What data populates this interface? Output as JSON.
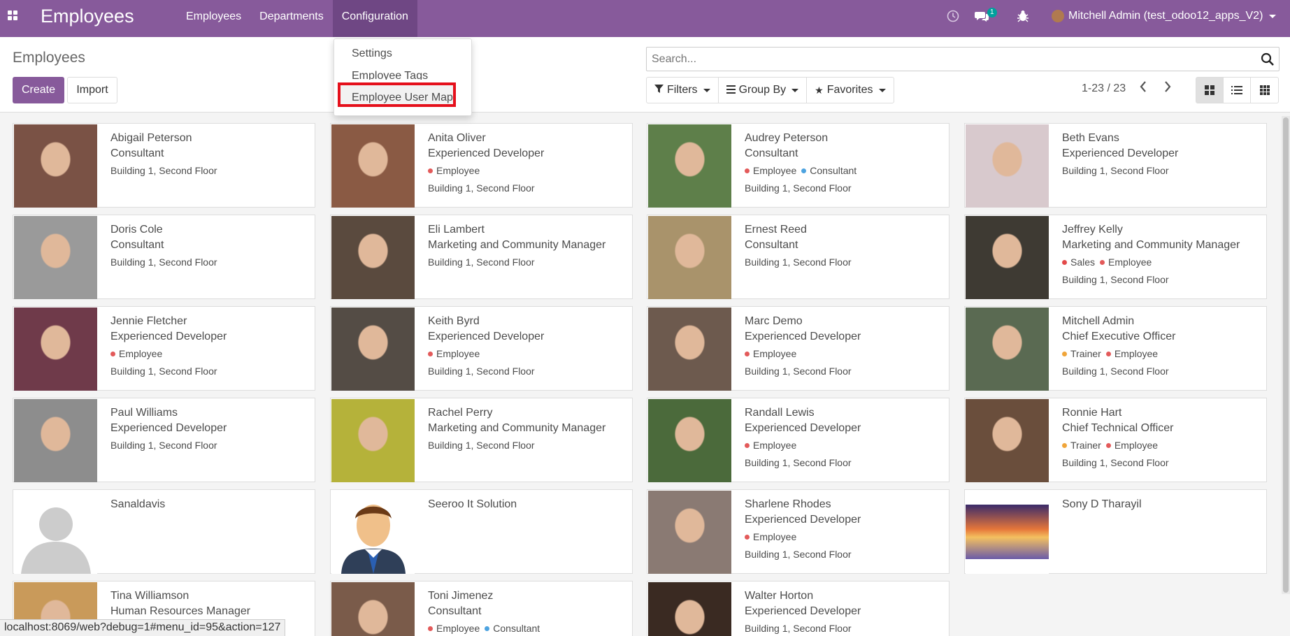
{
  "app": {
    "brand": "Employees",
    "menus": [
      {
        "label": "Employees"
      },
      {
        "label": "Departments"
      },
      {
        "label": "Configuration"
      }
    ],
    "chat_badge": "1",
    "user_label": "Mitchell Admin (test_odoo12_apps_V2)"
  },
  "dropdown": {
    "items": [
      {
        "label": "Settings"
      },
      {
        "label": "Employee Tags"
      },
      {
        "label": "Employee User Map"
      }
    ]
  },
  "control_panel": {
    "title": "Employees",
    "create_label": "Create",
    "import_label": "Import",
    "search_placeholder": "Search...",
    "filters_label": "Filters",
    "groupby_label": "Group By",
    "favorites_label": "Favorites",
    "pager": "1-23 / 23"
  },
  "tag_colors": {
    "Employee": "#e35a5a",
    "Consultant": "#4da3e0",
    "Sales": "#e34a4a",
    "Trainer": "#f0a53a"
  },
  "employees": [
    {
      "name": "Abigail Peterson",
      "job": "Consultant",
      "tags": [],
      "location": "Building 1, Second Floor",
      "photo": "#7a5245"
    },
    {
      "name": "Anita Oliver",
      "job": "Experienced Developer",
      "tags": [
        "Employee"
      ],
      "location": "Building 1, Second Floor",
      "photo": "#8a5a44"
    },
    {
      "name": "Audrey Peterson",
      "job": "Consultant",
      "tags": [
        "Employee",
        "Consultant"
      ],
      "location": "Building 1, Second Floor",
      "photo": "#5e7f4a"
    },
    {
      "name": "Beth Evans",
      "job": "Experienced Developer",
      "tags": [],
      "location": "Building 1, Second Floor",
      "photo": "#d8c9cd"
    },
    {
      "name": "Doris Cole",
      "job": "Consultant",
      "tags": [],
      "location": "Building 1, Second Floor",
      "photo": "#9a9a9a"
    },
    {
      "name": "Eli Lambert",
      "job": "Marketing and Community Manager",
      "tags": [],
      "location": "Building 1, Second Floor",
      "photo": "#5a4a3e"
    },
    {
      "name": "Ernest Reed",
      "job": "Consultant",
      "tags": [],
      "location": "Building 1, Second Floor",
      "photo": "#a9936b"
    },
    {
      "name": "Jeffrey Kelly",
      "job": "Marketing and Community Manager",
      "tags": [
        "Sales",
        "Employee"
      ],
      "location": "Building 1, Second Floor",
      "photo": "#3e3a33"
    },
    {
      "name": "Jennie Fletcher",
      "job": "Experienced Developer",
      "tags": [
        "Employee"
      ],
      "location": "Building 1, Second Floor",
      "photo": "#6f3a4a"
    },
    {
      "name": "Keith Byrd",
      "job": "Experienced Developer",
      "tags": [
        "Employee"
      ],
      "location": "Building 1, Second Floor",
      "photo": "#544c45"
    },
    {
      "name": "Marc Demo",
      "job": "Experienced Developer",
      "tags": [
        "Employee"
      ],
      "location": "Building 1, Second Floor",
      "photo": "#6d5a4e"
    },
    {
      "name": "Mitchell Admin",
      "job": "Chief Executive Officer",
      "tags": [
        "Trainer",
        "Employee"
      ],
      "location": "Building 1, Second Floor",
      "photo": "#5a6a52"
    },
    {
      "name": "Paul Williams",
      "job": "Experienced Developer",
      "tags": [],
      "location": "Building 1, Second Floor",
      "photo": "#8d8d8d"
    },
    {
      "name": "Rachel Perry",
      "job": "Marketing and Community Manager",
      "tags": [],
      "location": "Building 1, Second Floor",
      "photo": "#b5b23a"
    },
    {
      "name": "Randall Lewis",
      "job": "Experienced Developer",
      "tags": [
        "Employee"
      ],
      "location": "Building 1, Second Floor",
      "photo": "#4b6a3b"
    },
    {
      "name": "Ronnie Hart",
      "job": "Chief Technical Officer",
      "tags": [
        "Trainer",
        "Employee"
      ],
      "location": "Building 1, Second Floor",
      "photo": "#6a4e3c"
    },
    {
      "name": "Sanaldavis",
      "job": "",
      "tags": [],
      "location": "",
      "photo": "placeholder"
    },
    {
      "name": "Seeroo It Solution",
      "job": "",
      "tags": [],
      "location": "",
      "photo": "cartoon"
    },
    {
      "name": "Sharlene Rhodes",
      "job": "Experienced Developer",
      "tags": [
        "Employee"
      ],
      "location": "Building 1, Second Floor",
      "photo": "#8a7a73"
    },
    {
      "name": "Sony D Tharayil",
      "job": "",
      "tags": [],
      "location": "",
      "photo": "sunset"
    },
    {
      "name": "Tina Williamson",
      "job": "Human Resources Manager",
      "tags": [],
      "location": "",
      "photo": "#c99a5a"
    },
    {
      "name": "Toni Jimenez",
      "job": "Consultant",
      "tags": [
        "Employee",
        "Consultant"
      ],
      "location": "",
      "photo": "#7a5b4a"
    },
    {
      "name": "Walter Horton",
      "job": "Experienced Developer",
      "tags": [],
      "location": "Building 1, Second Floor",
      "photo": "#3a2a22"
    }
  ],
  "status_url": "localhost:8069/web?debug=1#menu_id=95&action=127"
}
